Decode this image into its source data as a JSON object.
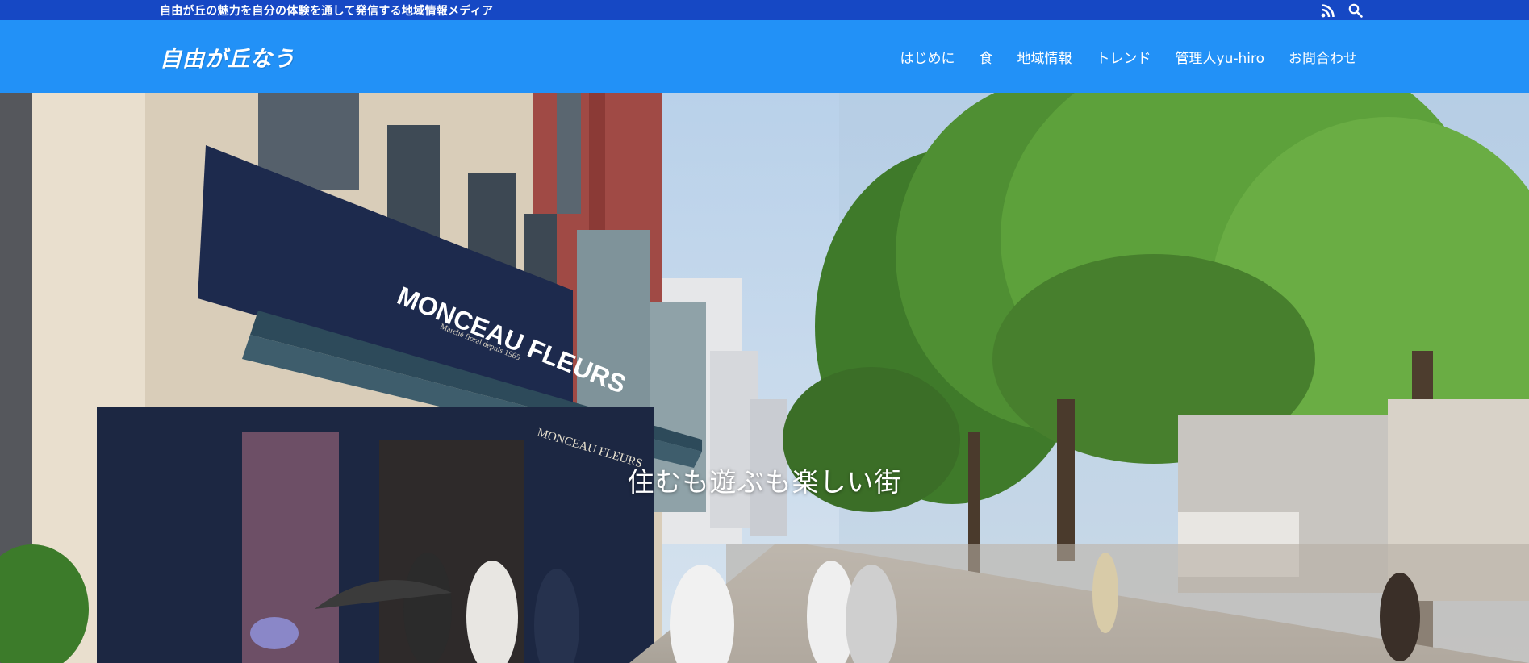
{
  "topbar": {
    "tagline": "自由が丘の魅力を自分の体験を通して発信する地域情報メディア",
    "icons": [
      "rss-icon",
      "search-icon"
    ]
  },
  "header": {
    "logo": "自由が丘なう",
    "nav": [
      {
        "label": "はじめに"
      },
      {
        "label": "食"
      },
      {
        "label": "地域情報"
      },
      {
        "label": "トレンド"
      },
      {
        "label": "管理人yu-hiro"
      },
      {
        "label": "お問合わせ"
      }
    ]
  },
  "hero": {
    "caption": "住むも遊ぶも楽しい街",
    "shop_sign": "MONCEAU FLEURS",
    "awning_text": "MONCEAU FLEURS",
    "sub_sign": "Marché floral depuis 1965"
  },
  "colors": {
    "topbar_bg": "#1648c4",
    "header_bg": "#2291f7",
    "text": "#ffffff"
  }
}
